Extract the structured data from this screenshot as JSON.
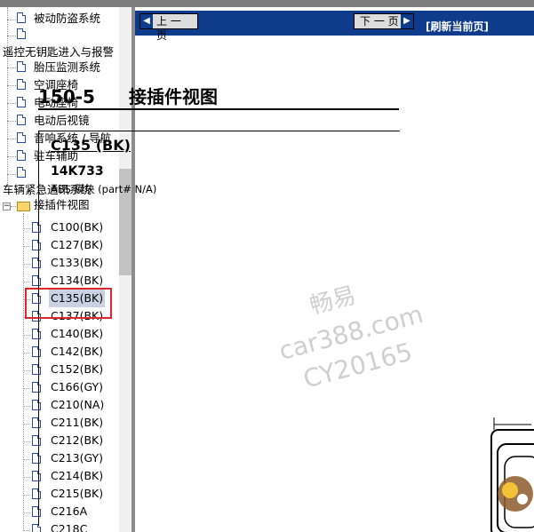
{
  "tree": {
    "items": [
      {
        "label": "被动防盗系统",
        "type": "doc"
      },
      {
        "label": "",
        "type": "doc"
      },
      {
        "label": "遥控无钥匙进入与报警",
        "type": "section"
      },
      {
        "label": "胎压监测系统",
        "type": "doc"
      },
      {
        "label": "空调座椅",
        "type": "doc"
      },
      {
        "label": "电动座椅",
        "type": "doc"
      },
      {
        "label": "电动后视镜",
        "type": "doc"
      },
      {
        "label": "音响系统 / 导航",
        "type": "doc"
      },
      {
        "label": "驻车辅助",
        "type": "doc"
      },
      {
        "label": "",
        "type": "doc"
      },
      {
        "label": "车辆紧急通讯系统",
        "type": "section"
      },
      {
        "label": "接插件视图",
        "type": "folder"
      }
    ],
    "connectors": [
      "C100(BK)",
      "C127(BK)",
      "C133(BK)",
      "C134(BK)",
      "C135(BK)",
      "C137(BK)",
      "C140(BK)",
      "C142(BK)",
      "C152(BK)",
      "C166(GY)",
      "C210(NA)",
      "C211(BK)",
      "C212(BK)",
      "C213(GY)",
      "C214(BK)",
      "C215(BK)",
      "C216A",
      "C218C"
    ],
    "selected": "C135(BK)"
  },
  "nav": {
    "prev_label": "上 一 页",
    "next_label": "下 一 页",
    "refresh_label": "[刷新当前页]"
  },
  "page": {
    "section_number": "150-5",
    "section_title": "接插件视图",
    "connector_name": "C135 (BK)",
    "part_number": "14K733",
    "description": "ABS 模块 (part# N/A)"
  },
  "watermark": {
    "line1": "畅易",
    "line2": "car388.com",
    "line3": "CY20165"
  },
  "colors": {
    "nav_blue": "#0e3b8c",
    "highlight_red": "#e0262b",
    "selection_bg": "#c8d2e3"
  }
}
